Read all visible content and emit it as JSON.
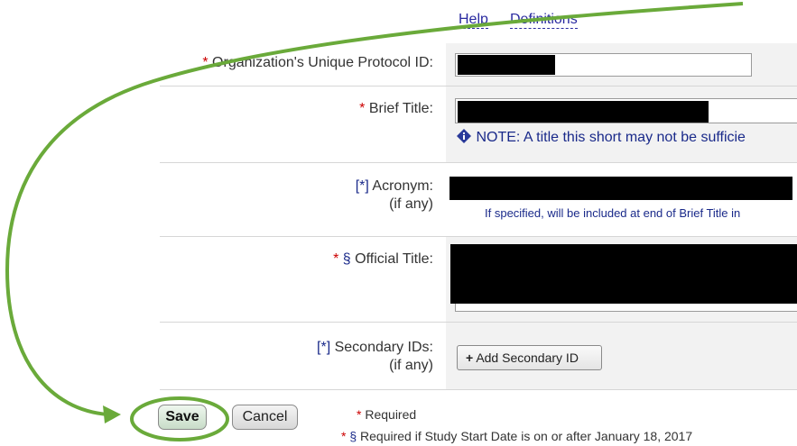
{
  "header_links": {
    "help": "Help",
    "definitions": "Definitions"
  },
  "fields": {
    "protocol_id": {
      "required": "*",
      "label": "Organization's Unique Protocol ID:"
    },
    "brief_title": {
      "required": "*",
      "label": "Brief Title:",
      "note": "NOTE: A title this short may not be sufficie"
    },
    "acronym": {
      "required": "[*]",
      "label": "Acronym:",
      "sub": "(if any)",
      "hint": "If specified, will be included at end of Brief Title in"
    },
    "official_title": {
      "required": "*",
      "section": "§",
      "label": "Official Title:"
    },
    "secondary_ids": {
      "required": "[*]",
      "label": "Secondary IDs:",
      "sub": "(if any)",
      "button_icon": "+",
      "button_label": "Add Secondary ID"
    }
  },
  "actions": {
    "save": "Save",
    "cancel": "Cancel"
  },
  "footnotes": {
    "required_star": "*",
    "required_text": "Required",
    "section_star": "*",
    "section_mark": "§",
    "section_text": "Required if Study Start Date is on or after January 18, 2017"
  },
  "icons": {
    "info": "info-diamond-icon",
    "plus": "plus-icon",
    "arrow": "curved-arrow-annotation"
  },
  "colors": {
    "annotation_green": "#6aaa3a",
    "required_red": "#cc0000",
    "link_blue": "#2a2aa0"
  }
}
